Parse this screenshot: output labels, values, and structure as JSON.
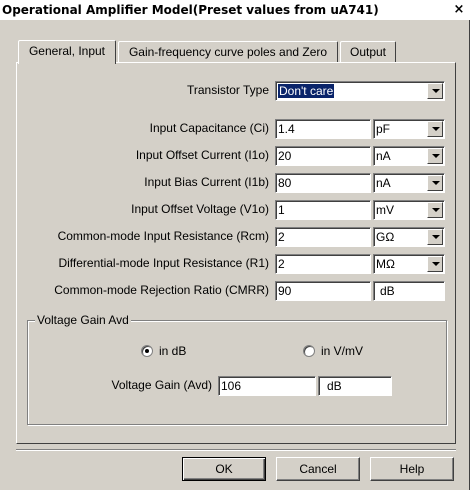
{
  "window": {
    "title": "Operational Amplifier Model(Preset values from uA741)",
    "close_glyph": "×"
  },
  "tabs": [
    {
      "label": "General, Input",
      "active": true
    },
    {
      "label": "Gain-frequency curve poles and Zero",
      "active": false
    },
    {
      "label": "Output",
      "active": false
    }
  ],
  "transistor_type": {
    "label": "Transistor Type",
    "value": "Don't care"
  },
  "params": [
    {
      "label": "Input Capacitance (Ci)",
      "value": "1.4",
      "unit": "pF",
      "unit_dropdown": true
    },
    {
      "label": "Input Offset Current (I1o)",
      "value": "20",
      "unit": "nA",
      "unit_dropdown": true
    },
    {
      "label": "Input Bias Current (I1b)",
      "value": "80",
      "unit": "nA",
      "unit_dropdown": true
    },
    {
      "label": "Input Offset Voltage (V1o)",
      "value": "1",
      "unit": "mV",
      "unit_dropdown": true
    },
    {
      "label": "Common-mode Input Resistance (Rcm)",
      "value": "2",
      "unit": "GΩ",
      "unit_dropdown": true
    },
    {
      "label": "Differential-mode Input Resistance (R1)",
      "value": "2",
      "unit": "MΩ",
      "unit_dropdown": true
    },
    {
      "label": "Common-mode Rejection Ratio (CMRR)",
      "value": "90",
      "unit": "dB",
      "unit_dropdown": false
    }
  ],
  "voltage_gain": {
    "group_title": "Voltage Gain Avd",
    "radio_db": "in dB",
    "radio_vmv": "in V/mV",
    "selected": "in dB",
    "label": "Voltage Gain (Avd)",
    "value": "106",
    "unit": "dB"
  },
  "buttons": {
    "ok": "OK",
    "cancel": "Cancel",
    "help": "Help"
  }
}
